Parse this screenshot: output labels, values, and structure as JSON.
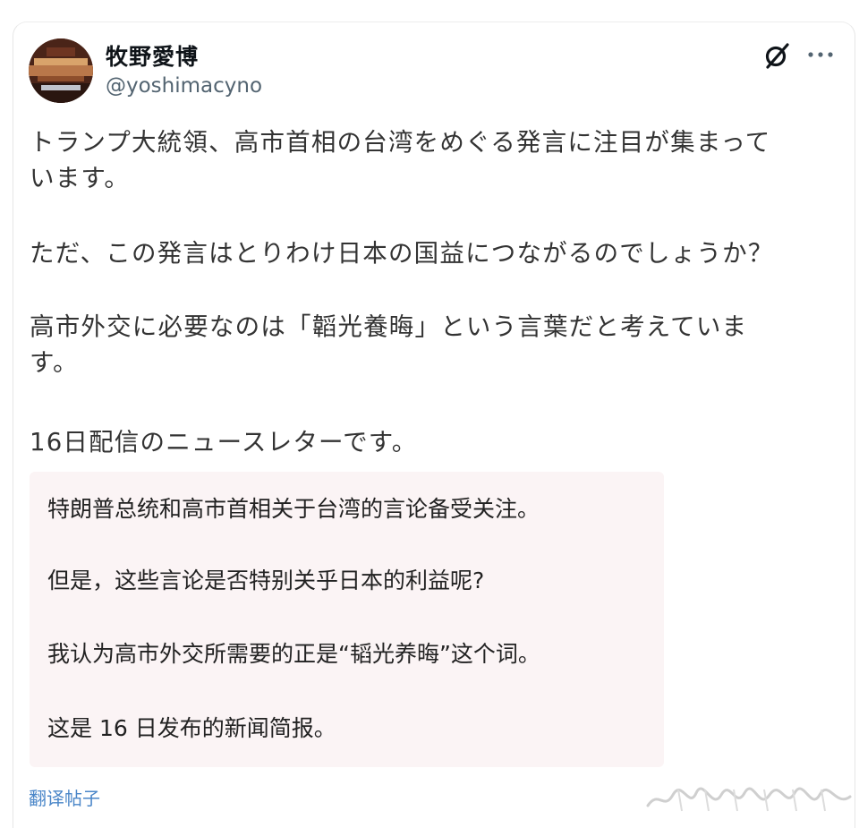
{
  "post": {
    "display_name": "牧野愛博",
    "handle": "@yoshimacyno",
    "paragraphs": [
      "トランプ大統領、高市首相の台湾をめぐる発言に注目が集まって\nいます。",
      "ただ、この発言はとりわけ日本の国益につながるのでしょうか？",
      "高市外交に必要なのは「韜光養晦」という言葉だと考えていま\nす。",
      "16日配信のニュースレターです。"
    ]
  },
  "translation": {
    "lines": [
      "特朗普总统和高市首相关于台湾的言论备受关注。",
      "但是，这些言论是否特别关乎日本的利益呢?",
      "我认为高市外交所需要的正是“韬光养晦”这个词。",
      "这是 16 日发布的新闻简报。"
    ],
    "link_label": "翻译帖子"
  },
  "icons": {
    "grok": "grok-icon",
    "more": "more-icon",
    "avatar": "avatar-image"
  },
  "colors": {
    "link": "#4a86c8",
    "translation_bg": "#fbf4f5",
    "handle": "#536471"
  }
}
